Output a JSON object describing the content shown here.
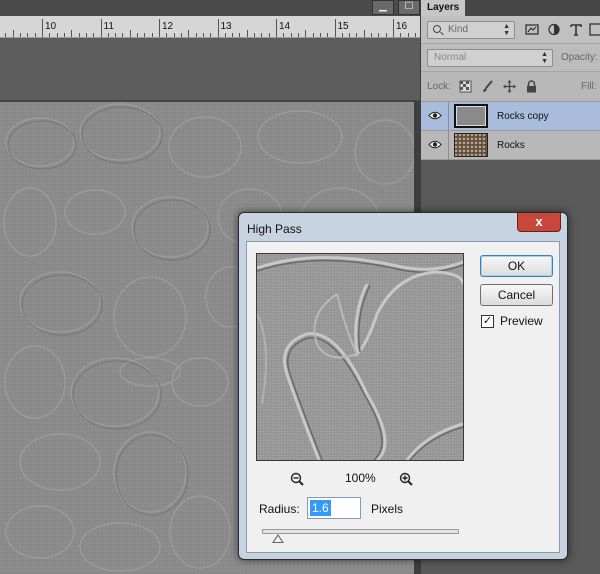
{
  "ruler": {
    "marks": [
      "10",
      "11",
      "12",
      "13",
      "14",
      "15",
      "16"
    ]
  },
  "layers_panel": {
    "tab_label": "Layers",
    "kind_filter": "Kind",
    "blend_mode": "Normal",
    "opacity_label": "Opacity:",
    "lock_label": "Lock:",
    "fill_label": "Fill:",
    "layers": [
      {
        "name": "Rocks copy",
        "selected": true,
        "visible": true
      },
      {
        "name": "Rocks",
        "selected": false,
        "visible": true
      }
    ]
  },
  "window_buttons": {
    "minimize": "▁",
    "maximize": "☐"
  },
  "dialog": {
    "title": "High Pass",
    "close_label": "x",
    "zoom_percent": "100%",
    "radius_label": "Radius:",
    "radius_value": "1.6",
    "units_label": "Pixels",
    "ok_label": "OK",
    "cancel_label": "Cancel",
    "preview_label": "Preview",
    "preview_checked": true,
    "slider_fraction": 0.08
  },
  "colors": {
    "selected_layer": "#a9bcdc",
    "dialog_frame": "#c7d3e0",
    "close_button": "#c9463d"
  }
}
